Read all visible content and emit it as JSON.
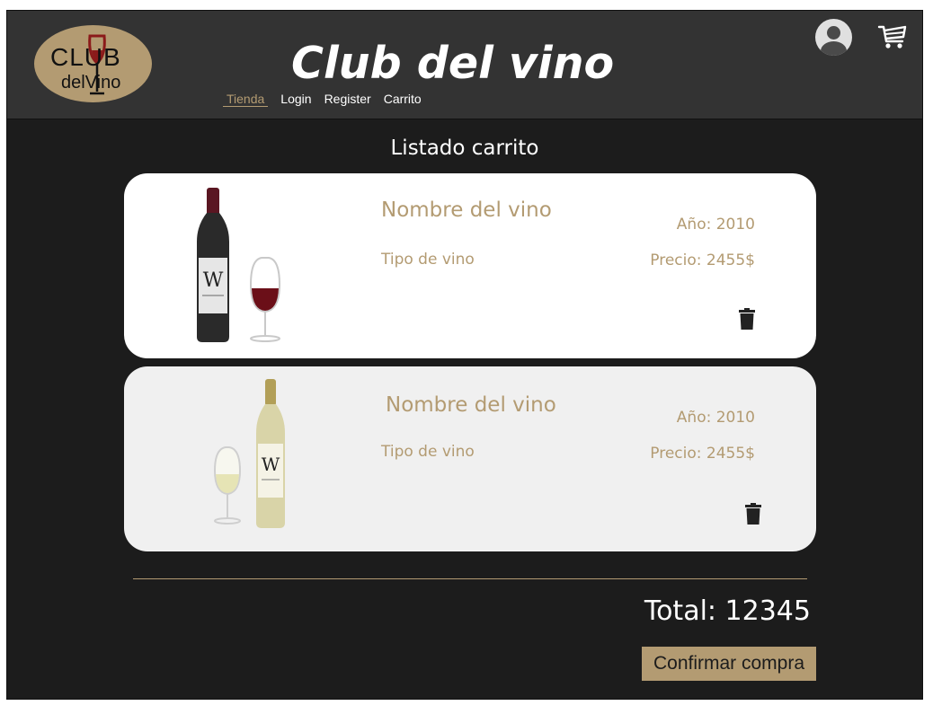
{
  "header": {
    "logo_line1": "CLUB",
    "logo_line2": "delVino",
    "site_title": "Club del vino",
    "nav": [
      "Tienda",
      "Login",
      "Register",
      "Carrito"
    ]
  },
  "page_heading": "Listado carrito",
  "cart_items": [
    {
      "name": "Nombre del vino",
      "type": "Tipo de vino",
      "year": "Año: 2010",
      "price": "Precio: 2455$",
      "wine_color": "red"
    },
    {
      "name": "Nombre del vino",
      "type": "Tipo de vino",
      "year": "Año: 2010",
      "price": "Precio: 2455$",
      "wine_color": "white"
    }
  ],
  "total": "Total: 12345",
  "confirm_label": "Confirmar compra",
  "colors": {
    "accent": "#b39b72",
    "background": "#1c1c1c",
    "header": "#333333"
  }
}
